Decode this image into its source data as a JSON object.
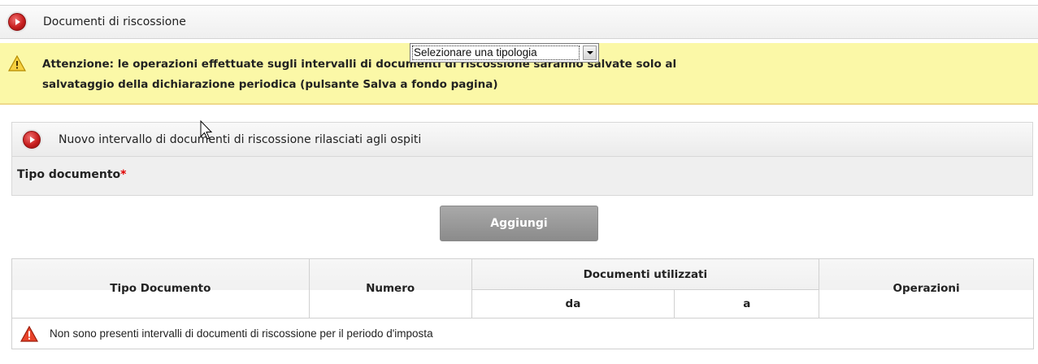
{
  "section_header": {
    "title": "Documenti di riscossione"
  },
  "warning": {
    "line1": "Attenzione: le operazioni effettuate sugli intervalli di documenti di riscossione saranno salvate solo al",
    "line2": "salvataggio della dichiarazione periodica (pulsante Salva a fondo pagina)"
  },
  "form_panel": {
    "title": "Nuovo intervallo di documenti di riscossione rilasciati agli ospiti",
    "tipo_label": "Tipo documento",
    "required_mark": "*",
    "select_value": "Selezionare una tipologia"
  },
  "add_button_label": "Aggiungi",
  "table": {
    "headers": {
      "tipo": "Tipo Documento",
      "numero": "Numero",
      "documenti_utilizzati": "Documenti utilizzati",
      "da": "da",
      "a": "a",
      "operazioni": "Operazioni"
    },
    "empty_message": "Non sono presenti intervalli di documenti di riscossione per il periodo d'imposta"
  },
  "icons": {
    "section": "red-circle-play-icon",
    "warning": "warning-triangle-icon",
    "empty": "red-warning-triangle-icon"
  },
  "colors": {
    "warning_bg": "#fbf8a7",
    "button_bg": "#9a9a9a",
    "accent_red": "#c81f1f"
  }
}
